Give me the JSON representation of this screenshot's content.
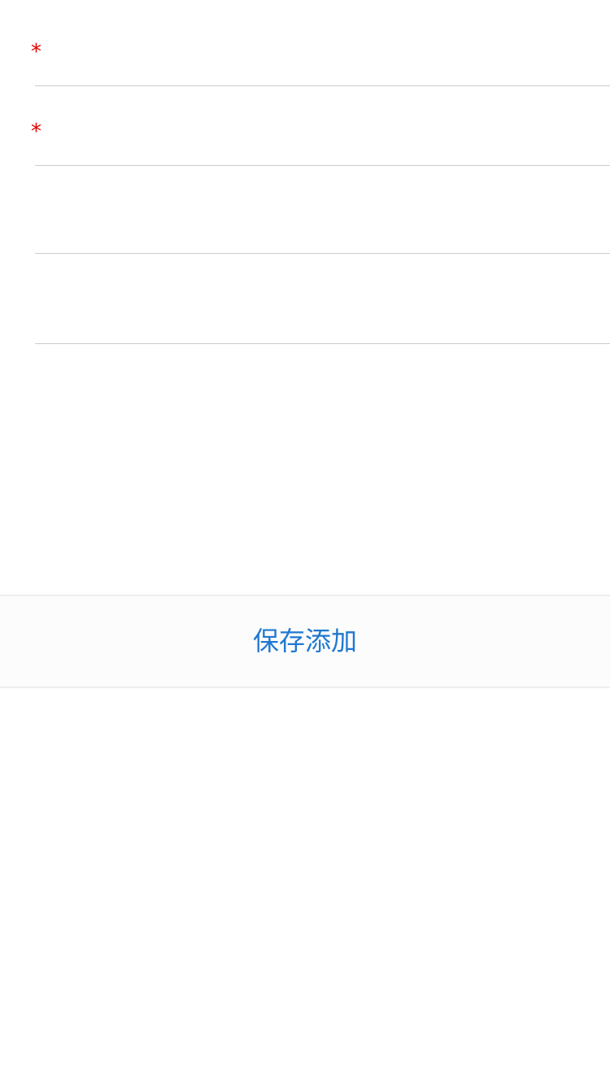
{
  "form": {
    "fields": [
      {
        "required_mark": "*",
        "value": "",
        "placeholder": ""
      },
      {
        "required_mark": "*",
        "value": "",
        "placeholder": ""
      },
      {
        "value": "",
        "placeholder": ""
      },
      {
        "value": "",
        "placeholder": ""
      }
    ]
  },
  "footer": {
    "save_label": "保存添加"
  },
  "colors": {
    "required": "#e00000",
    "accent": "#1f78d1",
    "divider": "#cccccc",
    "background": "#ffffff"
  }
}
